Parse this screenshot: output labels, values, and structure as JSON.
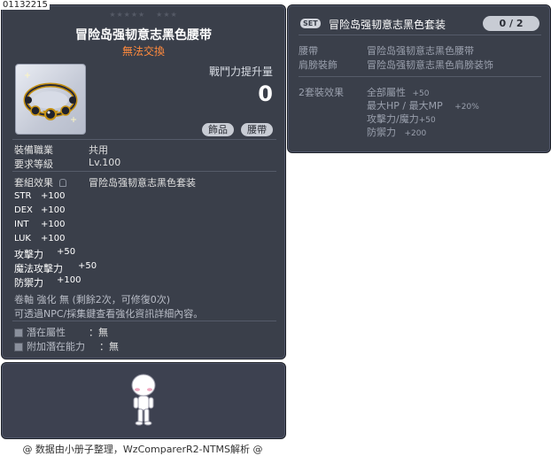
{
  "item_id": "01132215",
  "item": {
    "title": "冒险岛强韧意志黑色腰带",
    "trade_status": "無法交換",
    "power_label": "戰鬥力提升量",
    "power_value": "0",
    "tags": [
      "飾品",
      "腰帶"
    ],
    "job_label": "裝備職業",
    "job_value": "共用",
    "level_label": "要求等級",
    "level_value": "Lv.100",
    "set_label": "套組效果",
    "set_name": "冒险岛强韧意志黑色套装",
    "stats": [
      {
        "label": "STR",
        "value": "+100"
      },
      {
        "label": "DEX",
        "value": "+100"
      },
      {
        "label": "INT",
        "value": "+100"
      },
      {
        "label": "LUK",
        "value": "+100"
      },
      {
        "label": "攻擊力",
        "value": "+50"
      },
      {
        "label": "魔法攻擊力",
        "value": "+50"
      },
      {
        "label": "防禦力",
        "value": "+100"
      }
    ],
    "enhance_line": "卷軸 強化 無 (剩餘2次，可修復0次)",
    "enhance_hint": "可透過NPC/採集鍵查看強化資訊詳細內容。",
    "potential_label": "潛在屬性",
    "potential_value": "：無",
    "add_potential_label": "附加潛在能力",
    "add_potential_value": "：無"
  },
  "set": {
    "badge": "SET",
    "title": "冒险岛强韧意志黑色套装",
    "count": "0 / 2",
    "pieces": [
      {
        "slot": "腰帶",
        "name": "冒险岛强韧意志黑色腰带"
      },
      {
        "slot": "肩膀裝飾",
        "name": "冒险岛强韧意志黑色肩膀装饰"
      }
    ],
    "effect_label": "2套裝效果",
    "effects": [
      {
        "name": "全部屬性",
        "value": "+50"
      },
      {
        "name": "最大HP / 最大MP",
        "value": "+20%"
      },
      {
        "name": "攻擊力/魔力",
        "value": "+50"
      },
      {
        "name": "防禦力",
        "value": "+200"
      }
    ]
  },
  "footer": "@ 数据由小册子整理，WzComparerR2-NTMS解析 @",
  "colors": {
    "panel_bg": "#3a3f4a",
    "trade_text": "#ff8a3d",
    "set_text": "#9aa0ad"
  },
  "icons": {
    "item": "belt-icon",
    "stars": "star-icon",
    "potential": "square-bullet-icon",
    "set_lock": "lock-icon"
  }
}
